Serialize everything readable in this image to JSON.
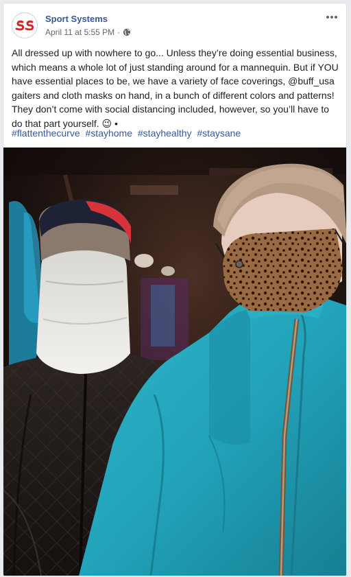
{
  "post": {
    "author": "Sport Systems",
    "timestamp": "April 11 at 5:55 PM",
    "separator": "·",
    "text": "All dressed up with nowhere to go... Unless they’re doing essential business, which means a whole lot of just standing around for a mannequin. But if YOU have essential places to be, we have a variety of face coverings, @buff_usa gaiters and cloth masks on hand, in a bunch of different colors and patterns! They don’t come with social distancing included, however, so you’ll have to do that part yourself.",
    "emoji": "😉",
    "trailing": "•",
    "hashtags": [
      "#flattenthecurve",
      "#stayhome",
      "#stayhealthy",
      "#staysane"
    ]
  },
  "icons": {
    "logo": "sport-systems-logo",
    "audience": "globe-icon",
    "menu": "more-options-icon"
  },
  "colors": {
    "link": "#385898",
    "meta": "#606770",
    "logo_red": "#d7262b"
  }
}
